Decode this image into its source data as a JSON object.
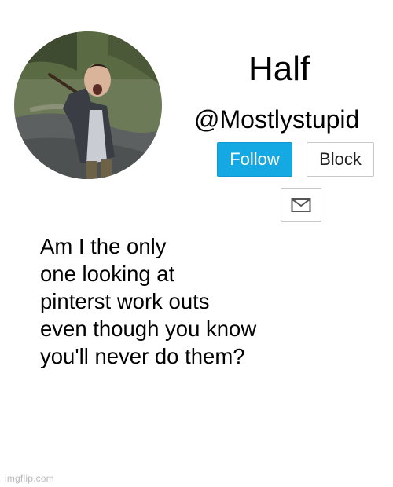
{
  "profile": {
    "display_name": "Half",
    "handle": "@Mostlystupid",
    "avatar_icon": "profile-photo"
  },
  "actions": {
    "follow_label": "Follow",
    "block_label": "Block",
    "message_icon": "envelope-icon"
  },
  "post": {
    "text": "Am I the only\none looking at\npinterst work outs\neven though you know\nyou'll never do them?"
  },
  "watermark": {
    "text": "imgflip.com"
  },
  "colors": {
    "follow_button": "#14a9e3",
    "follow_text": "#ffffff",
    "background": "#ffffff"
  }
}
